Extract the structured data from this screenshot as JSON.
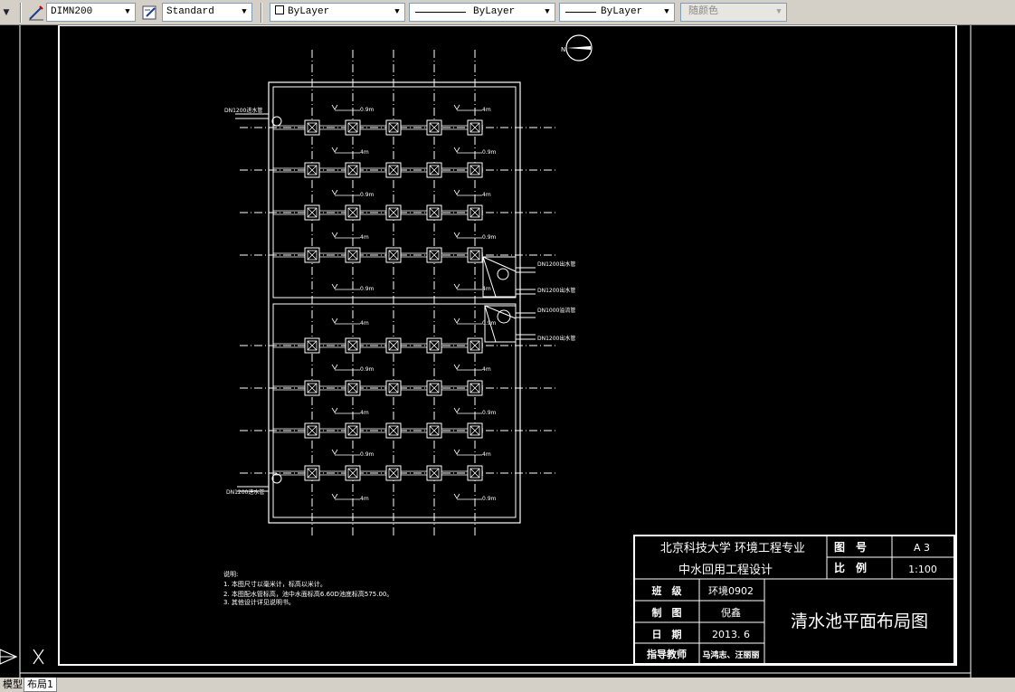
{
  "toolbar": {
    "dim_style": "DIMN200",
    "text_style": "Standard",
    "layer": "ByLayer",
    "linetype": "ByLayer",
    "lineweight": "ByLayer",
    "plot_style": "随颜色"
  },
  "drawing": {
    "title_block": {
      "school": "北京科技大学 环境工程专业",
      "project": "中水回用工程设计",
      "drawing_no_label": "图　号",
      "drawing_no": "A 3",
      "scale_label": "比　例",
      "scale": "1:100",
      "class_label": "班　级",
      "class_value": "环境0902",
      "drawn_label": "制　图",
      "drawn_value": "倪鑫",
      "date_label": "日　期",
      "date_value": "2013. 6",
      "advisor_label": "指导教师",
      "advisor_value": "马鸿志、汪丽丽",
      "drawing_title": "清水池平面布局图"
    },
    "notes": {
      "title": "说明:",
      "line1": "1. 本图尺寸以毫米计，标高以米计。",
      "line2": "2. 本图配水管标高，池中水面标高6.60D池底标高575.00。",
      "line3": "3. 其他设计详见说明书。"
    },
    "labels": {
      "inlet_top": "DN1200进水管",
      "inlet_bottom": "DN1200进水管",
      "outlet_1": "DN1200出水管",
      "outlet_2": "DN1200出水管",
      "outlet_3": "DN1000溢流管",
      "outlet_4": "DN1200出水管",
      "level_a": "0.9m",
      "level_b": "4m"
    }
  },
  "tabs": {
    "model": "模型",
    "layout1": "布局1"
  }
}
